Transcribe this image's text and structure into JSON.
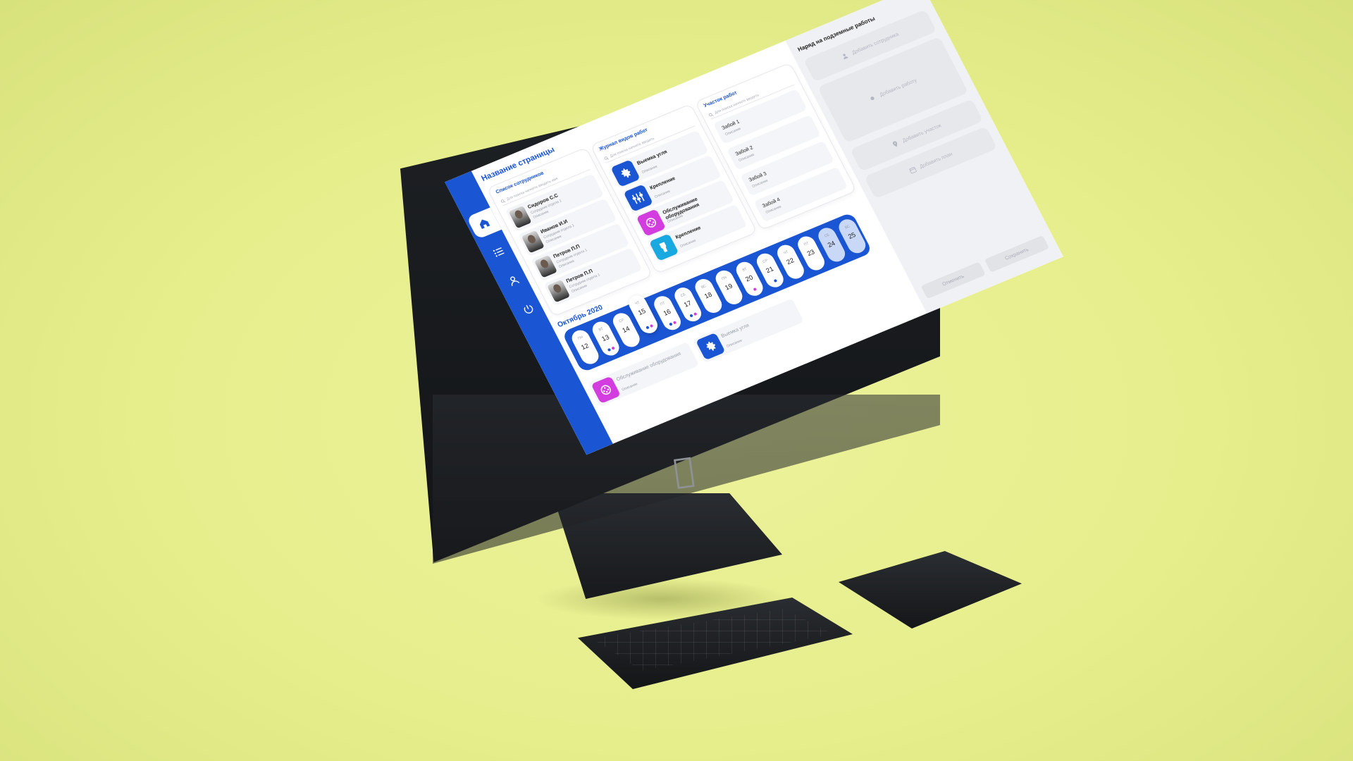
{
  "app": {
    "page_title": "Название страницы"
  },
  "sidebar": {
    "items": [
      {
        "icon": "home-icon",
        "active": true
      },
      {
        "icon": "list-icon",
        "active": false
      },
      {
        "icon": "user-icon",
        "active": false
      },
      {
        "icon": "power-icon",
        "active": false
      }
    ]
  },
  "employees": {
    "title": "Список сотрудников",
    "search_placeholder": "Для поиска начните вводить имя",
    "items": [
      {
        "name": "Сидоров С.С",
        "role": "Сотрудник отдела 1",
        "desc": "Описание"
      },
      {
        "name": "Иванов И.И",
        "role": "Сотрудник отдела 1",
        "desc": "Описание"
      },
      {
        "name": "Петров П.П",
        "role": "Сотрудник отдела 1",
        "desc": "Описание"
      },
      {
        "name": "Петров П.П",
        "role": "Сотрудник отдела 1",
        "desc": "Описание"
      }
    ]
  },
  "jobs": {
    "title": "Журнал видов работ",
    "search_placeholder": "Для поиска начните вводить",
    "items": [
      {
        "name": "Выемка угля",
        "desc": "Описание",
        "icon": "gear-icon",
        "color": "#1a55d4"
      },
      {
        "name": "Крепление",
        "desc": "Описание",
        "icon": "supports-icon",
        "color": "#1a55d4"
      },
      {
        "name": "Обслуживание оборудования",
        "desc": "Описание",
        "icon": "equipment-icon",
        "color": "#d33de0"
      },
      {
        "name": "Крепление",
        "desc": "Описание",
        "icon": "drill-icon",
        "color": "#19a8e0"
      }
    ]
  },
  "sites": {
    "title": "Участок работ",
    "search_placeholder": "Для поиска начните вводить",
    "items": [
      {
        "name": "Забой 1",
        "desc": "Описание"
      },
      {
        "name": "Забой 2",
        "desc": "Описание"
      },
      {
        "name": "Забой 3",
        "desc": "Описание"
      },
      {
        "name": "Забой 4",
        "desc": "Описание"
      }
    ]
  },
  "calendar": {
    "month": "Октябрь 2020",
    "days": [
      {
        "dow": "ПН",
        "num": "12",
        "dots": []
      },
      {
        "dow": "ВТ",
        "num": "13",
        "dots": [
          "#1a55d4",
          "#d33de0"
        ]
      },
      {
        "dow": "СР",
        "num": "14",
        "dots": []
      },
      {
        "dow": "ЧТ",
        "num": "15",
        "dots": [
          "#1a55d4",
          "#d33de0"
        ],
        "selected": true
      },
      {
        "dow": "ПТ",
        "num": "16",
        "dots": [
          "#1a55d4",
          "#d33de0"
        ]
      },
      {
        "dow": "СБ",
        "num": "17",
        "dots": [
          "#1a55d4",
          "#d33de0"
        ]
      },
      {
        "dow": "ВС",
        "num": "18",
        "dots": []
      },
      {
        "dow": "ПН",
        "num": "19",
        "dots": []
      },
      {
        "dow": "ВТ",
        "num": "20",
        "dots": [
          "#d33de0"
        ]
      },
      {
        "dow": "СР",
        "num": "21",
        "dots": [
          "#1a55d4"
        ]
      },
      {
        "dow": "ЧТ",
        "num": "22",
        "dots": []
      },
      {
        "dow": "ПТ",
        "num": "23",
        "dots": []
      },
      {
        "dow": "СБ",
        "num": "24",
        "dots": [],
        "muted": true
      },
      {
        "dow": "ВС",
        "num": "25",
        "dots": [],
        "muted": true
      }
    ]
  },
  "events": [
    {
      "name": "Обслуживание оборудования",
      "desc": "Описание",
      "icon": "equipment-icon",
      "color": "#d33de0"
    },
    {
      "name": "Выемка угля",
      "desc": "Описание",
      "icon": "gear-icon",
      "color": "#1a55d4"
    }
  ],
  "drawer": {
    "title": "Наряд на подземные работы",
    "add_employee": "Добавить сотрудника",
    "add_work": "Добавить работу",
    "add_site": "Добавить участок",
    "add_plan": "Добавить план",
    "cancel": "Отменить",
    "save": "Сохранить"
  }
}
